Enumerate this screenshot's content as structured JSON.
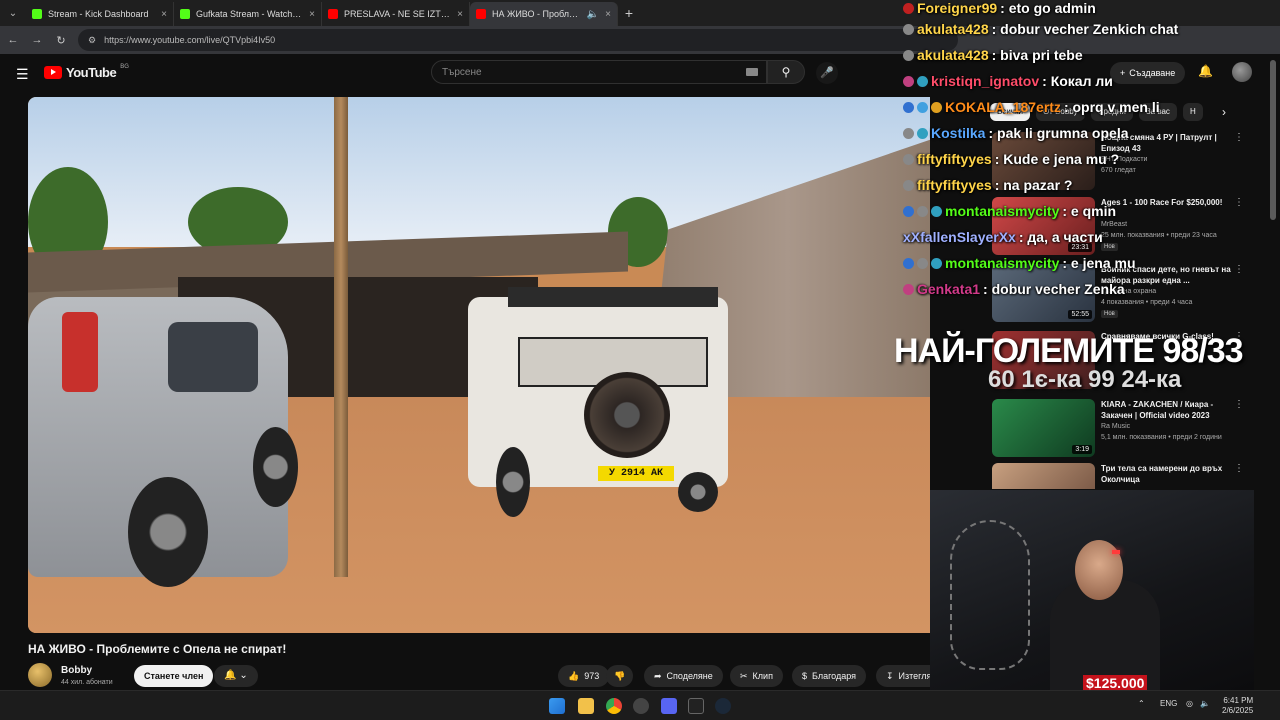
{
  "browser": {
    "tabs": [
      {
        "title": "Stream - Kick Dashboard",
        "favicon_color": "#53fc18",
        "active": false
      },
      {
        "title": "Gufkata Stream - Watch Live o",
        "favicon_color": "#53fc18",
        "active": false
      },
      {
        "title": "PRESLAVA - NE SE IZTRIVASH /",
        "favicon_color": "#ff0000",
        "active": false
      },
      {
        "title": "НА ЖИВО - Проблемите с",
        "favicon_color": "#ff0000",
        "active": true
      }
    ],
    "url": "https://www.youtube.com/live/QTVpbi4Iv50"
  },
  "youtube": {
    "logo_text": "YouTube",
    "country": "BG",
    "search_placeholder": "Търсене",
    "create_label": "Създаване"
  },
  "video": {
    "title": "НА ЖИВО - Проблемите с Опела не спират!",
    "plate": "У 2914 АК",
    "channel_name": "Bobby",
    "subscribers": "44 хил. абонати",
    "join_label": "Станете член",
    "likes": "973",
    "share_label": "Споделяне",
    "clip_label": "Клип",
    "thanks_label": "Благодаря",
    "download_label": "Изтегляне"
  },
  "chips": [
    {
      "label": "Всички",
      "active": true
    },
    {
      "label": "От Bobby",
      "active": false
    },
    {
      "label": "Сродни",
      "active": false
    },
    {
      "label": "За вас",
      "active": false
    },
    {
      "label": "Н",
      "active": false
    }
  ],
  "recommendations": [
    {
      "title": "Нощна смяна 4 РУ | Патрулт | Епизод 43",
      "channel": "БНТ Подкасти",
      "meta": "670 гледат",
      "duration": "",
      "badge": "",
      "thumb": "#6a4a3a"
    },
    {
      "title": "Ages 1 - 100 Race For $250,000!",
      "channel": "MrBeast",
      "meta": "25 млн. показвания • преди 23 часа",
      "duration": "23:31",
      "badge": "Нов",
      "thumb": "#b33a3a"
    },
    {
      "title": "Воиник спаси дете, но гневът на майора разкри една ...",
      "channel": "Гранична охрана",
      "meta": "4 показвания • преди 4 часа",
      "duration": "52:55",
      "badge": "Нов",
      "thumb": "#4a5868"
    },
    {
      "title": "Сравняваме всички G-class!",
      "channel": "",
      "meta": "",
      "duration": "",
      "badge": "",
      "thumb": "#8a2a2a"
    },
    {
      "title": "KIARA - ZAKACHEN / Киара - Закачен | Official video 2023",
      "channel": "Ra Music",
      "meta": "5,1 млн. показвания • преди 2 години",
      "duration": "3:19",
      "badge": "",
      "thumb": "#1f6a3a"
    },
    {
      "title": "Три тела са намерени до връх Околчица",
      "channel": "",
      "meta": "",
      "duration": "",
      "badge": "",
      "thumb": "#a87a60"
    }
  ],
  "chat": [
    {
      "user": "Foreigner99",
      "msg": ": eto go admin",
      "color": "#ffd54a"
    },
    {
      "user": "akulata428",
      "msg": ": dobur vecher Zenkich chat",
      "color": "#ffd54a"
    },
    {
      "user": "akulata428",
      "msg": ": biva pri tebe",
      "color": "#ffd54a"
    },
    {
      "user": "kristiqn_ignatov",
      "msg": ": Кокал ли",
      "color": "#ff4d6a"
    },
    {
      "user": "KOKALA_187ertz",
      "msg": ": oprq v men li",
      "color": "#ff8c1a"
    },
    {
      "user": "Kostilka",
      "msg": ": pak li grumna opela",
      "color": "#5aa8ff"
    },
    {
      "user": "fiftyfiftyyes",
      "msg": ": Kude e jena mu ?",
      "color": "#ffd54a"
    },
    {
      "user": "fiftyfiftyyes",
      "msg": ": na pazar ?",
      "color": "#ffd54a"
    },
    {
      "user": "montanaismycity",
      "msg": ": e qmin",
      "color": "#53fc18"
    },
    {
      "user": "xXfallenSlayerXx",
      "msg": ": да, а части",
      "color": "#9fb0ff"
    },
    {
      "user": "montanaismycity",
      "msg": ": e jena mu",
      "color": "#53fc18"
    },
    {
      "user": "Genkata1",
      "msg": ": dobur vecher Zenka",
      "color": "#d23a8a"
    }
  ],
  "overlay": {
    "counter_main": "НАЙ-ГОЛЕМИТЕ 98/33",
    "counter_sub": "60 1є-ка 99 24-ка",
    "donation": "$125.000"
  },
  "taskbar": {
    "lang": "ENG",
    "time": "6:41 PM",
    "date": "2/6/2025"
  }
}
